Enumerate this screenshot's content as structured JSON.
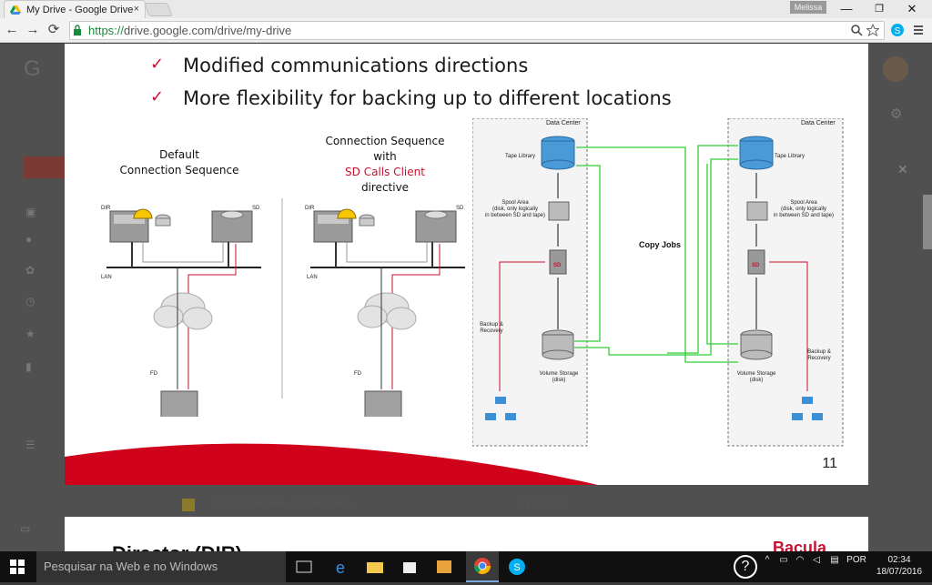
{
  "browser": {
    "tab_title": "My Drive - Google Drive",
    "tab_close": "×",
    "profile_name": "Melissa",
    "url_scheme": "https://",
    "url_rest": "drive.google.com/drive/my-drive",
    "window_controls": {
      "minimize": "—",
      "restore": "❐",
      "close": "✕"
    }
  },
  "nav": {
    "back": "←",
    "forward": "→",
    "reload": "⟳"
  },
  "background_page": {
    "file_name": "copy_of_Modelo_apresentado1",
    "file_date": "Jul 7, 2016"
  },
  "slide": {
    "bullets": [
      "Modified communications directions",
      "More flexibility for backing up to different locations"
    ],
    "check_mark": "✓",
    "diagram_left": {
      "title_line1": "Default",
      "title_line2": "Connection Sequence",
      "labels": {
        "dir": "DIR",
        "sd": "SD",
        "lan": "LAN",
        "fd": "FD"
      }
    },
    "diagram_mid": {
      "title_line1": "Connection Sequence",
      "title_line2": "with",
      "title_line3": "SD Calls Client",
      "title_line4": "directive",
      "labels": {
        "dir": "DIR",
        "sd": "SD",
        "lan": "LAN",
        "fd": "FD"
      }
    },
    "datacenter": {
      "title": "Data Center",
      "tape_library": "Tape Library",
      "spool_line1": "Spool Area",
      "spool_line2": "(disk, only logically",
      "spool_line3": "in between SD and tape)",
      "sd": "SD",
      "volume_line1": "Volume Storage",
      "volume_line2": "(disk)",
      "backup_line1": "Backup &",
      "backup_line2": "Recovery"
    },
    "copy_jobs": "Copy Jobs",
    "page_number": "11",
    "accent_color": "#c8102e"
  },
  "slide2": {
    "title_fragment": "Director (DIR)",
    "logo_text": "Bacula"
  },
  "taskbar": {
    "search_placeholder": "Pesquisar na Web e no Windows",
    "language": "POR",
    "time": "02:34",
    "date": "18/07/2016"
  }
}
